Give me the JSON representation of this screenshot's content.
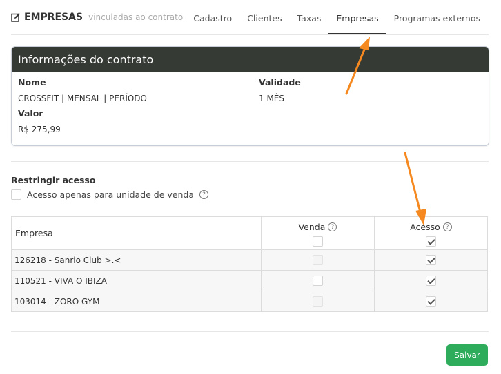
{
  "header": {
    "title": "EMPRESAS",
    "subtitle": "vinculadas ao contrato",
    "tabs": [
      {
        "label": "Cadastro",
        "active": false
      },
      {
        "label": "Clientes",
        "active": false
      },
      {
        "label": "Taxas",
        "active": false
      },
      {
        "label": "Empresas",
        "active": true
      },
      {
        "label": "Programas externos",
        "active": false
      }
    ]
  },
  "contract": {
    "heading": "Informações do contrato",
    "name_label": "Nome",
    "name_value": "CROSSFIT | MENSAL | PERÍODO",
    "validity_label": "Validade",
    "validity_value": "1 MÊS",
    "value_label": "Valor",
    "value_value": "R$ 275,99"
  },
  "restrict": {
    "title": "Restringir acesso",
    "checkbox_label": "Acesso apenas para unidade de venda",
    "checked": false
  },
  "table": {
    "col_company": "Empresa",
    "col_sale": "Venda",
    "col_access": "Acesso",
    "header_sale_checked": false,
    "header_access_checked": true,
    "rows": [
      {
        "company": "126218 - Sanrio Club >.<",
        "sale": false,
        "access": true
      },
      {
        "company": "110521 - VIVA O IBIZA",
        "sale": false,
        "access": true
      },
      {
        "company": "103014 - ZORO GYM",
        "sale": false,
        "access": true
      }
    ]
  },
  "actions": {
    "save_label": "Salvar"
  },
  "colors": {
    "dark_header": "#353a34",
    "save_green": "#2eac5c",
    "annotation_arrow": "#f5891f"
  },
  "icons": {
    "title": "edit-icon",
    "help": "help-icon"
  }
}
